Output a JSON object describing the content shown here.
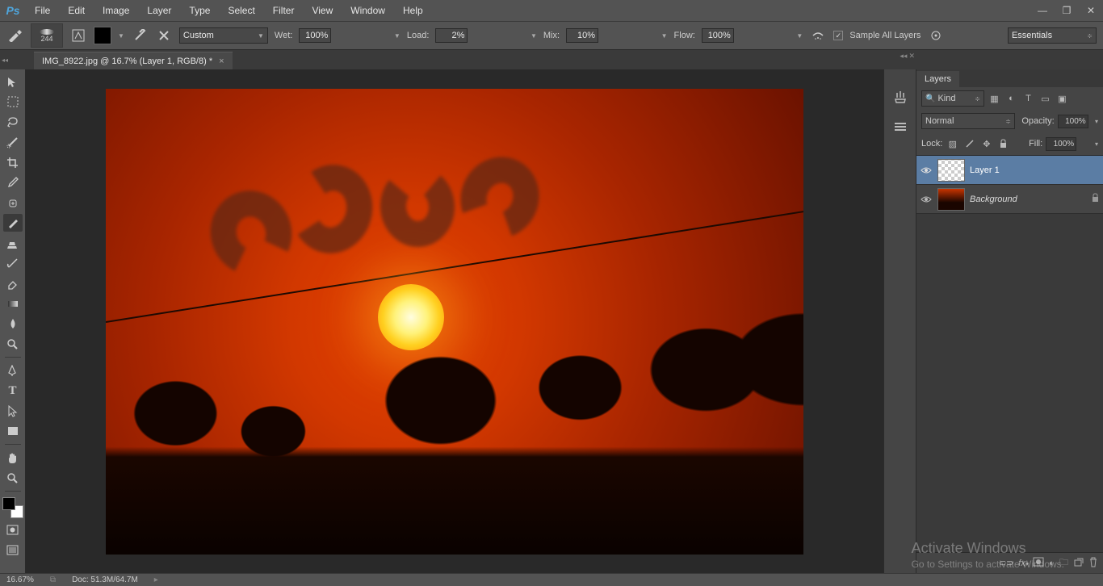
{
  "app": {
    "logo": "Ps"
  },
  "menu": [
    "File",
    "Edit",
    "Image",
    "Layer",
    "Type",
    "Select",
    "Filter",
    "View",
    "Window",
    "Help"
  ],
  "optbar": {
    "brush_size": "244",
    "preset_label": "Custom",
    "wet_label": "Wet:",
    "wet_value": "100%",
    "load_label": "Load:",
    "load_value": "2%",
    "mix_label": "Mix:",
    "mix_value": "10%",
    "flow_label": "Flow:",
    "flow_value": "100%",
    "sample_label": "Sample All Layers",
    "workspace": "Essentials"
  },
  "doc_tab": {
    "title": "IMG_8922.jpg @ 16.7% (Layer 1, RGB/8) *"
  },
  "layers_panel": {
    "tab": "Layers",
    "kind_label": "Kind",
    "blend_mode": "Normal",
    "opacity_label": "Opacity:",
    "opacity_value": "100%",
    "lock_label": "Lock:",
    "fill_label": "Fill:",
    "fill_value": "100%",
    "layers": [
      {
        "name": "Layer 1",
        "selected": true,
        "thumb": "trans"
      },
      {
        "name": "Background",
        "selected": false,
        "thumb": "img",
        "locked": true
      }
    ]
  },
  "status": {
    "zoom": "16.67%",
    "doc_label": "Doc:",
    "doc_value": "51.3M/64.7M"
  },
  "watermark": {
    "title": "Activate Windows",
    "sub": "Go to Settings to activate Windows."
  }
}
